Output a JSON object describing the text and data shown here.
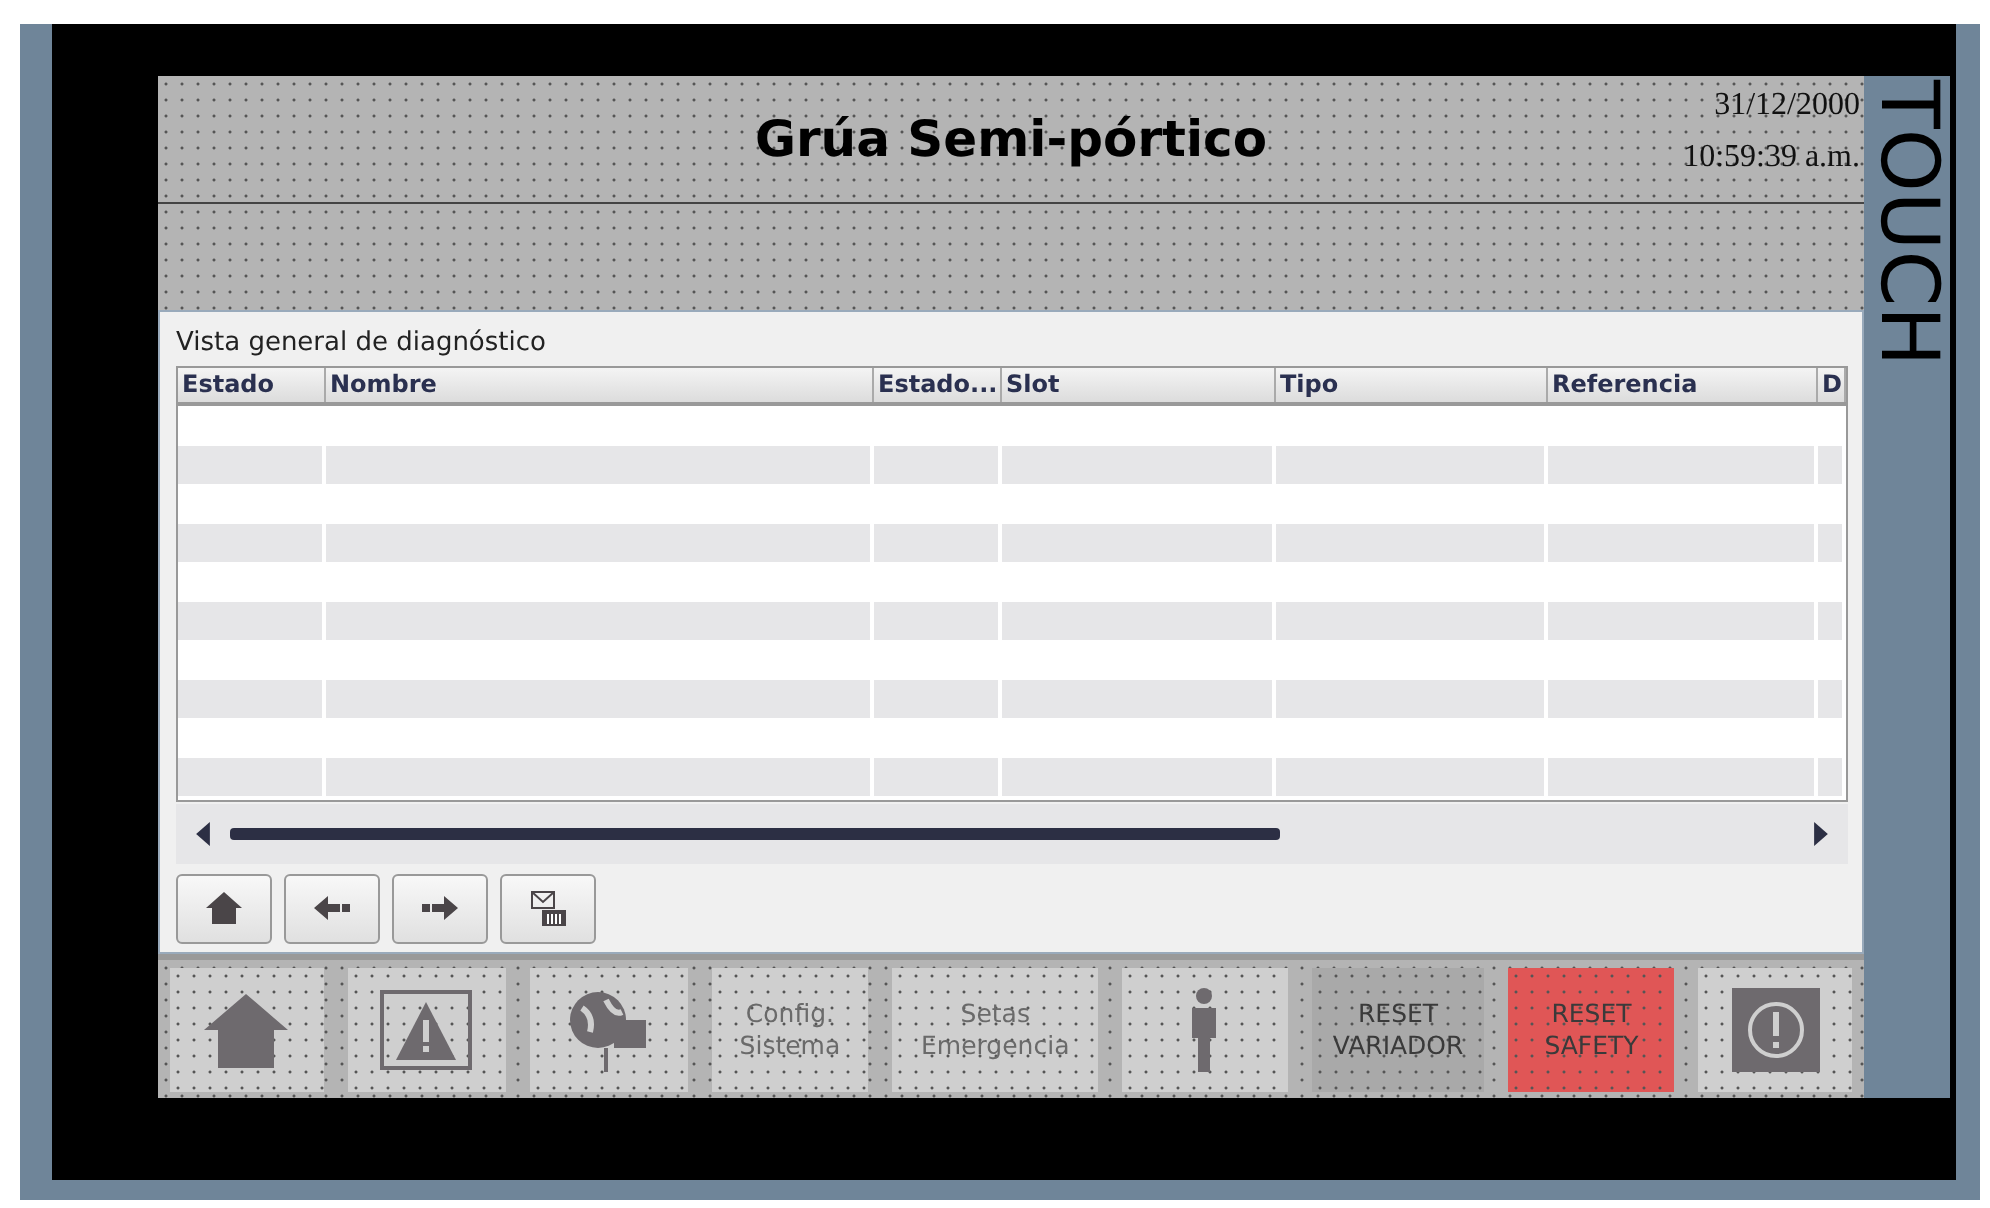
{
  "header": {
    "title": "Grúa Semi-pórtico",
    "date": "31/12/2000",
    "time": "10:59:39 a.m."
  },
  "brand": "TOUCH",
  "diagnostics": {
    "title": "Vista general de diagnóstico",
    "columns": [
      "Estado",
      "Nombre",
      "Estado...",
      "Slot",
      "Tipo",
      "Referencia",
      "D"
    ],
    "nav_buttons": [
      {
        "kind": "home"
      },
      {
        "kind": "back"
      },
      {
        "kind": "forward"
      },
      {
        "kind": "messages"
      }
    ]
  },
  "bottom_buttons": [
    {
      "kind": "home"
    },
    {
      "kind": "warning"
    },
    {
      "kind": "globe"
    },
    {
      "kind": "text",
      "label": "Config.\nSistema"
    },
    {
      "kind": "text",
      "label": "Setas\nEmergencia"
    },
    {
      "kind": "person"
    },
    {
      "kind": "text",
      "label": "RESET\nVARIADOR",
      "color": "#a9a9a9"
    },
    {
      "kind": "text",
      "label": "RESET\nSAFETY",
      "color": "#e05656"
    },
    {
      "kind": "info"
    }
  ]
}
